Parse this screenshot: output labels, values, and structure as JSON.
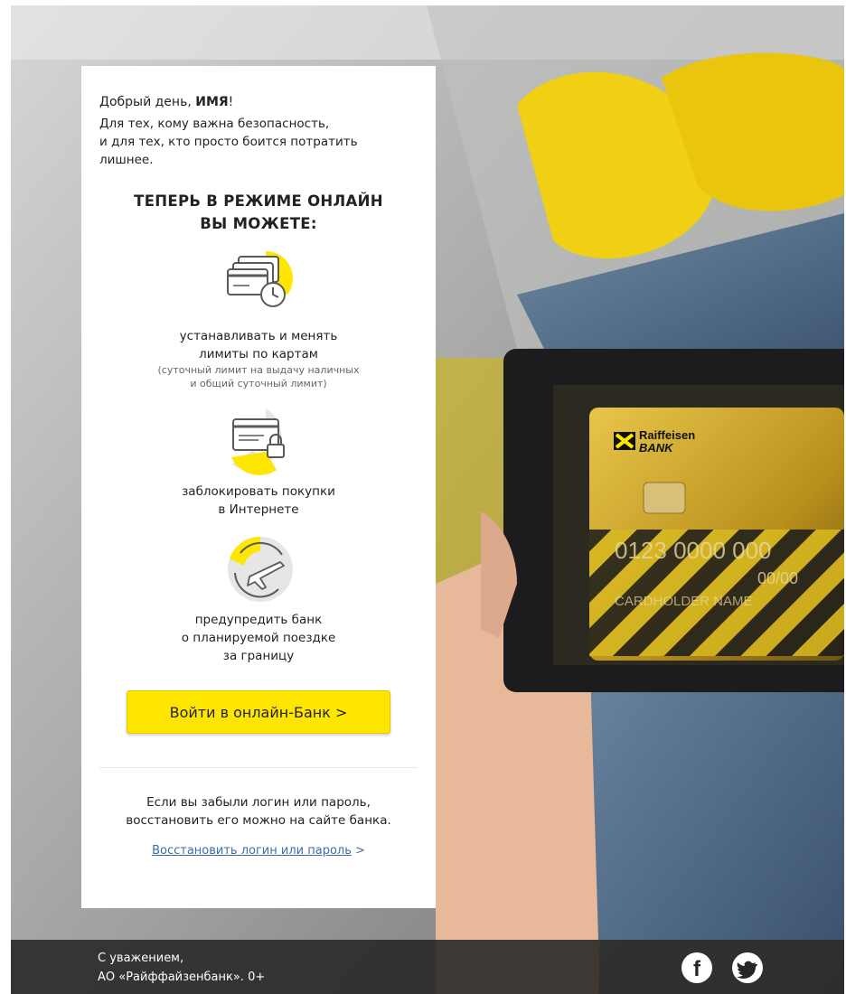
{
  "greeting": {
    "prefix": "Добрый день, ",
    "name": "ИМЯ",
    "suffix": "!"
  },
  "intro": {
    "line1": "Для тех, кому важна безопасность,",
    "line2": "и для тех, кто просто боится потратить",
    "line3": "лишнее."
  },
  "headline": {
    "line1": "ТЕПЕРЬ В РЕЖИМЕ ОНЛАЙН",
    "line2": "ВЫ МОЖЕТЕ:"
  },
  "features": [
    {
      "icon": "cards-clock-icon",
      "line1": "устанавливать и менять",
      "line2": "лимиты по картам",
      "note1": "(суточный лимит на выдачу наличных",
      "note2": "и общий суточный лимит)"
    },
    {
      "icon": "card-lock-icon",
      "line1": "заблокировать покупки",
      "line2": "в Интернете"
    },
    {
      "icon": "plane-travel-icon",
      "line1": "предупредить банк",
      "line2": "о планируемой поездке",
      "line3": "за границу"
    }
  ],
  "login_button": {
    "label": "Войти в онлайн-Банк",
    "arrow": ">"
  },
  "forgot": {
    "line1": "Если вы забыли логин или пароль,",
    "line2": "восстановить его можно на сайте банка."
  },
  "recover_link": {
    "label": "Восстановить логин или пароль",
    "arrow": ">"
  },
  "bank_card": {
    "brand_line1": "Raiffeisen",
    "brand_line2": "BANK",
    "number": "0123 0000 000",
    "expiry": "00/00",
    "holder": "CARDHOLDER NAME"
  },
  "footer": {
    "line1": "С уважением,",
    "line2": "АО «Райффайзенбанк». 0+",
    "facebook": "f"
  },
  "colors": {
    "brand_yellow": "#fee600",
    "link_blue": "#3b6ea8",
    "footer_bg": "#262626"
  }
}
